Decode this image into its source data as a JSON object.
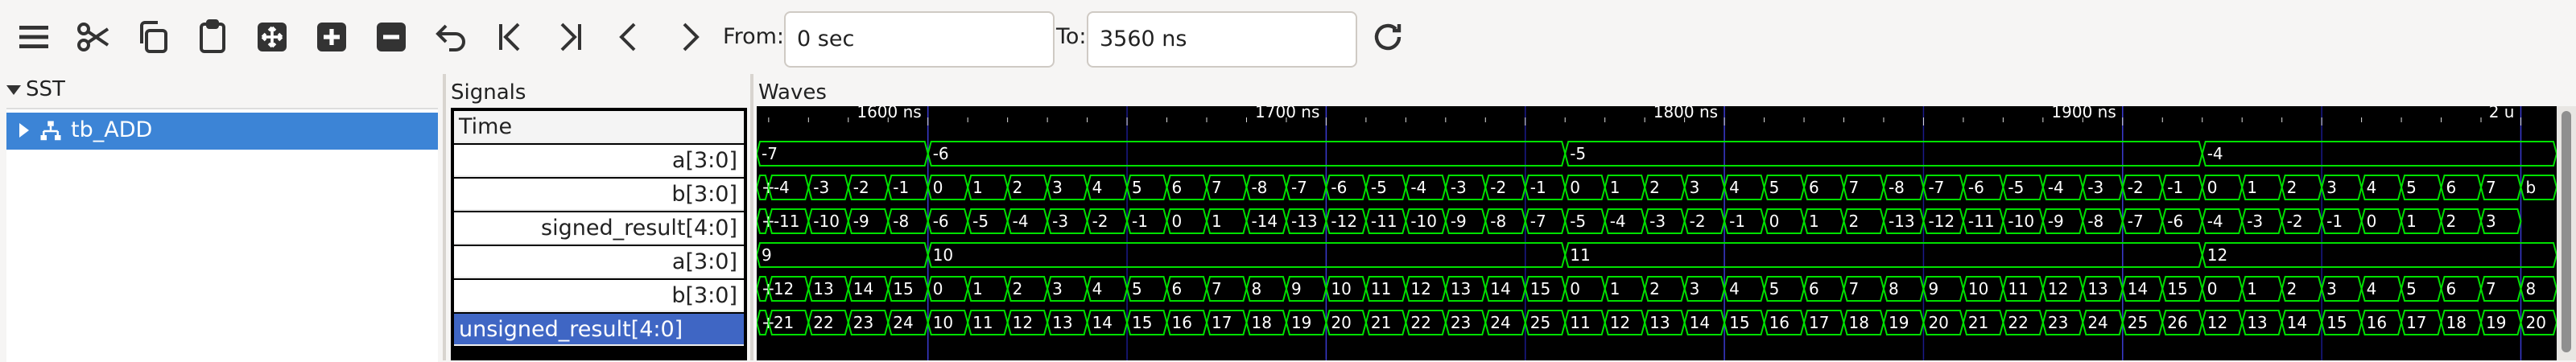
{
  "toolbar": {
    "icons": [
      "menu-icon",
      "cut-icon",
      "copy-icon",
      "paste-icon",
      "zoom-fit-icon",
      "zoom-in-icon",
      "zoom-out-icon",
      "undo-icon",
      "first-icon",
      "last-icon",
      "prev-icon",
      "next-icon"
    ],
    "from_label": "From:",
    "from_value": "0 sec",
    "to_label": "To:",
    "to_value": "3560 ns",
    "reload_icon": "reload-icon"
  },
  "sst": {
    "title": "SST",
    "tree_item": "tb_ADD"
  },
  "signals": {
    "title": "Signals",
    "rows": [
      "Time",
      "a[3:0]",
      "b[3:0]",
      "signed_result[4:0]",
      "a[3:0]",
      "b[3:0]",
      "unsigned_result[4:0]"
    ]
  },
  "waves": {
    "title": "Waves",
    "colors": {
      "background": "#000000",
      "trace": "#00e000",
      "text": "#ffffff",
      "grid": "#1a1a8a",
      "selection": "#3f66c4"
    },
    "time_labels": [
      {
        "t": 1600,
        "text": "1600 ns"
      },
      {
        "t": 1700,
        "text": "1700 ns"
      },
      {
        "t": 1800,
        "text": "1800 ns"
      },
      {
        "t": 1900,
        "text": "1900 ns"
      },
      {
        "t": 2000,
        "text": "2 u"
      }
    ],
    "t_start": 1557,
    "t_end": 2009,
    "rows": [
      {
        "start": 1557,
        "step": 40,
        "values": [
          "-7",
          "-6",
          "-5",
          "-4"
        ],
        "first_partial": true,
        "first_start": 1557,
        "first_end": 1600
      },
      {
        "start": 1557,
        "step": 10,
        "values": [
          "+",
          "-4",
          "-3",
          "-2",
          "-1",
          "0",
          "1",
          "2",
          "3",
          "4",
          "5",
          "6",
          "7",
          "-8",
          "-7",
          "-6",
          "-5",
          "-4",
          "-3",
          "-2",
          "-1",
          "0",
          "1",
          "2",
          "3",
          "4",
          "5",
          "6",
          "7",
          "-8",
          "-7",
          "-6",
          "-5",
          "-4",
          "-3",
          "-2",
          "-1",
          "0",
          "1",
          "2",
          "3",
          "4",
          "5",
          "6",
          "7",
          "b"
        ]
      },
      {
        "start": 1557,
        "step": 10,
        "values": [
          "+",
          "-11",
          "-10",
          "-9",
          "-8",
          "-6",
          "-5",
          "-4",
          "-3",
          "-2",
          "-1",
          "0",
          "1",
          "-14",
          "-13",
          "-12",
          "-11",
          "-10",
          "-9",
          "-8",
          "-7",
          "-5",
          "-4",
          "-3",
          "-2",
          "-1",
          "0",
          "1",
          "2",
          "-13",
          "-12",
          "-11",
          "-10",
          "-9",
          "-8",
          "-7",
          "-6",
          "-4",
          "-3",
          "-2",
          "-1",
          "0",
          "1",
          "2",
          "3"
        ]
      },
      {
        "start": 1557,
        "step": 40,
        "values": [
          "9",
          "10",
          "11",
          "12"
        ]
      },
      {
        "start": 1557,
        "step": 10,
        "values": [
          "+",
          "12",
          "13",
          "14",
          "15",
          "0",
          "1",
          "2",
          "3",
          "4",
          "5",
          "6",
          "7",
          "8",
          "9",
          "10",
          "11",
          "12",
          "13",
          "14",
          "15",
          "0",
          "1",
          "2",
          "3",
          "4",
          "5",
          "6",
          "7",
          "8",
          "9",
          "10",
          "11",
          "12",
          "13",
          "14",
          "15",
          "0",
          "1",
          "2",
          "3",
          "4",
          "5",
          "6",
          "7",
          "8"
        ]
      },
      {
        "start": 1557,
        "step": 10,
        "values": [
          "+",
          "21",
          "22",
          "23",
          "24",
          "10",
          "11",
          "12",
          "13",
          "14",
          "15",
          "16",
          "17",
          "18",
          "19",
          "20",
          "21",
          "22",
          "23",
          "24",
          "25",
          "11",
          "12",
          "13",
          "14",
          "15",
          "16",
          "17",
          "18",
          "19",
          "20",
          "21",
          "22",
          "23",
          "24",
          "25",
          "26",
          "12",
          "13",
          "14",
          "15",
          "16",
          "17",
          "18",
          "19",
          "20"
        ]
      }
    ]
  }
}
